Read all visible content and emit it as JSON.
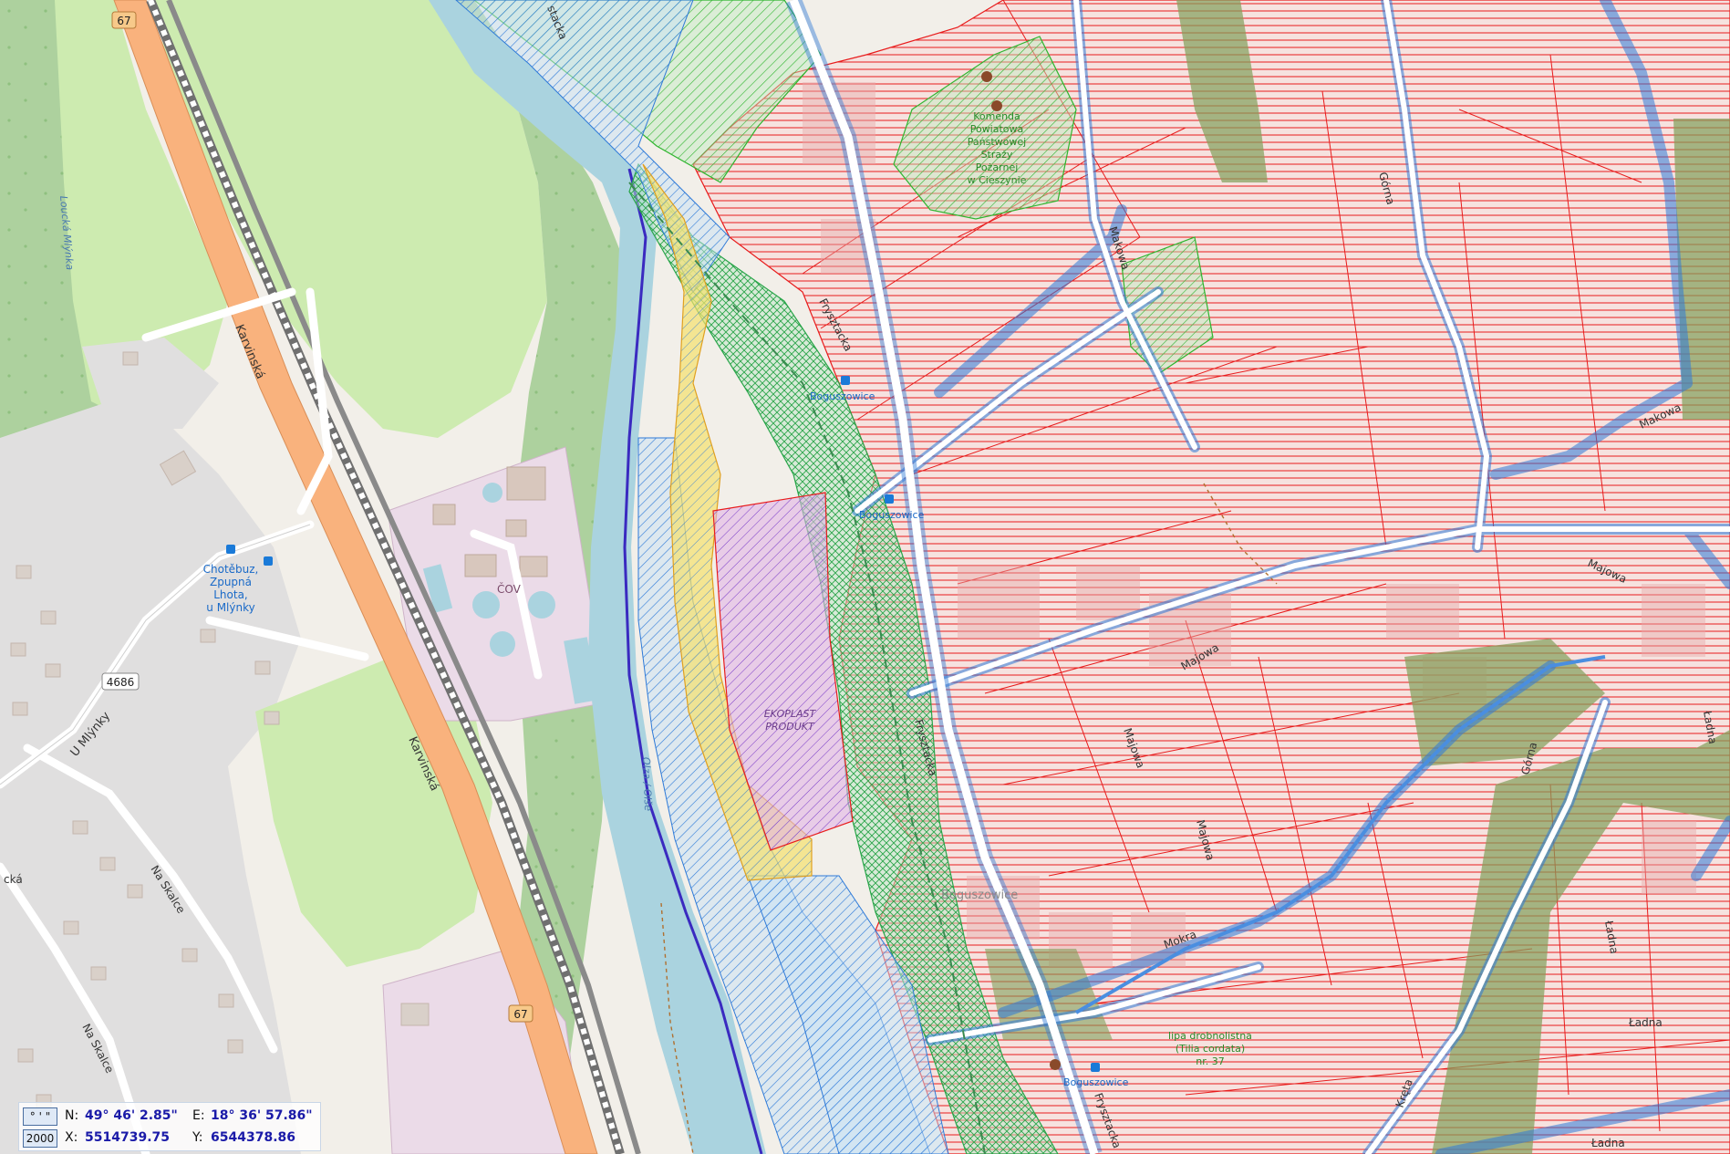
{
  "map": {
    "roads": {
      "karvinska": "Karvinská",
      "route_67_a": "67",
      "route_67_b": "67",
      "route_4686": "4686",
      "u_mlynky": "U Mlýnky",
      "na_skalce_a": "Na Skalce",
      "na_skalce_b": "Na Skalce",
      "fryszacka_a": "Frysztacka",
      "fryszacka_b": "Frysztacka",
      "fryszacka_c": "Frysztacka",
      "fryszacka_d": "Frysztacka",
      "makowa_a": "Makowa",
      "makowa_b": "Makowa",
      "majowa_a": "Majowa",
      "majowa_b": "Majowa",
      "majowa_c": "Majowa",
      "majowa_d": "Majowa",
      "mokra": "Mokra",
      "gora": "Górna",
      "ladna_a": "Ładna",
      "ladna_b": "Ładna",
      "ladna_c": "Ładna",
      "ladna_d": "Ładna",
      "krata": "Kręta",
      "kiska": "cká",
      "stacka": "stacka",
      "olza": "Olza / Olše",
      "mlynka": "Loucká Mlýnka"
    },
    "places": {
      "bus_stop": [
        "Chotěbuz,",
        "Zpupná",
        "Lhota,",
        "u Mlýnky"
      ],
      "cov": "ČOV",
      "fire_station": [
        "Komenda",
        "Powiatowa",
        "Państwowej",
        "Straży",
        "Pożarnej",
        "w Cieszynie"
      ],
      "ekoplast": [
        "EKOPLAST",
        "PRODUKT"
      ],
      "boguszowice_station_a": "Boguszowice",
      "boguszowice_station_b": "Boguszowice",
      "boguszowice_station_c": "Boguszowice",
      "boguszowice_town": "Boguszowice",
      "tree": [
        "lipa drobnolistna",
        "(Tilia cordata)",
        "nr. 37"
      ]
    },
    "colors": {
      "red_zone": "#e81c1c",
      "blue_zone": "#2e7ad8",
      "green_zone": "#3fbf3f",
      "yellow_zone": "#f2c400",
      "purple_zone": "#8a3ac8",
      "river": "#aad3df",
      "forest": "#add19e",
      "meadow": "#cdebb0",
      "industrial": "#ebdbe8",
      "residential": "#e0dfdf",
      "motorway": "#f9b27d"
    }
  },
  "coords": {
    "format_btn": "° ' \"",
    "scale_btn": "2000",
    "n_label": "N:",
    "n_value": "49° 46' 2.85\"",
    "e_label": "E:",
    "e_value": "18° 36' 57.86\"",
    "x_label": "X:",
    "x_value": "5514739.75",
    "y_label": "Y:",
    "y_value": "6544378.86"
  }
}
